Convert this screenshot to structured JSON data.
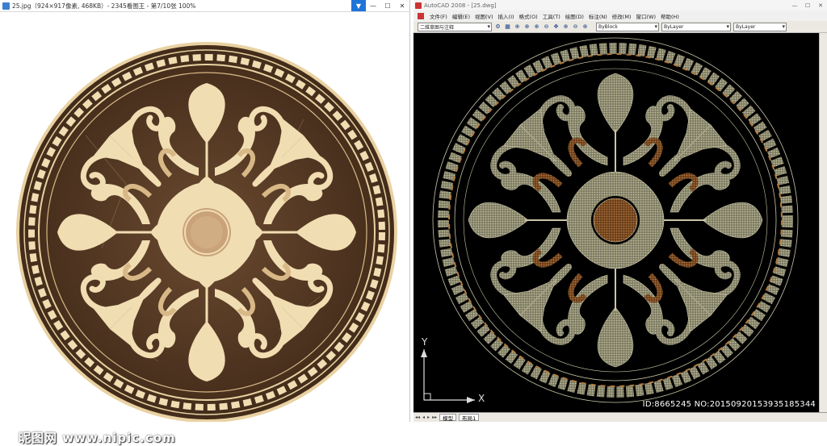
{
  "viewer": {
    "title": "25.jpg（924×917像素, 468KB）- 2345看图王 - 第7/10张 100%",
    "watermark": "昵图网 www.nipic.com",
    "buttons": {
      "menu": "▼",
      "minimize": "—",
      "maximize": "☐",
      "close": "✕"
    }
  },
  "cad": {
    "title": "AutoCAD 2008 - [25.dwg]",
    "buttons": {
      "minimize": "—",
      "maximize": "☐",
      "close": "✕"
    },
    "menu": [
      "文件(F)",
      "编辑(E)",
      "视图(V)",
      "插入(I)",
      "格式(O)",
      "工具(T)",
      "绘图(D)",
      "标注(N)",
      "修改(M)",
      "窗口(W)",
      "帮助(H)"
    ],
    "workspace": "二维草图与注释",
    "layer_color": "ByBlock",
    "linetype": "ByLayer",
    "lineweight": "ByLayer",
    "tabs": [
      "模型",
      "布局1"
    ],
    "ucs_x": "X",
    "ucs_y": "Y",
    "id_text": "ID:8665245 NO:20150920153935185344"
  },
  "colors": {
    "marble_dark": "#4a3220",
    "marble_light": "#f1ddb2",
    "cad_bg": "#000000",
    "cad_beige": "#9c9a7c",
    "cad_brown": "#8a5528",
    "cad_line": "#c9c6a8"
  },
  "icons": [
    "app-icon",
    "menu-arrow-icon",
    "minimize-icon",
    "maximize-icon",
    "close-icon",
    "zoom-icon",
    "pan-icon",
    "layer-icon"
  ]
}
